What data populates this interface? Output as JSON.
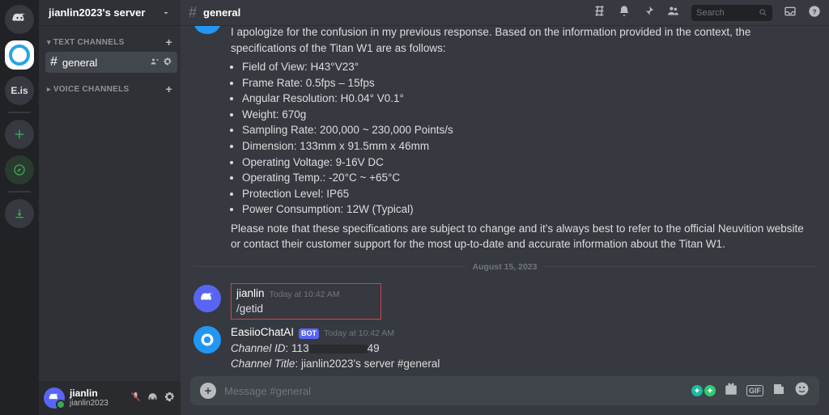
{
  "server_rail": {
    "items": [
      "discord",
      "selected",
      "eis",
      "add",
      "explore",
      "download"
    ],
    "eis_label": "E.is"
  },
  "sidebar": {
    "server_name": "jianlin2023's server",
    "groups": [
      {
        "label": "TEXT CHANNELS",
        "channels": [
          {
            "name": "general",
            "active": true
          }
        ]
      },
      {
        "label": "VOICE CHANNELS",
        "channels": []
      }
    ]
  },
  "user_panel": {
    "display_name": "jianlin",
    "username": "jianlin2023"
  },
  "topbar": {
    "channel_name": "general",
    "search_placeholder": "Search"
  },
  "messages": {
    "partial_top": {
      "text_before_list": "I apologize for the confusion in my previous response. Based on the information provided in the context, the specifications of the Titan W1 are as follows:",
      "specs": [
        "Field of View: H43°V23°",
        "Frame Rate: 0.5fps – 15fps",
        "Angular Resolution: H0.04° V0.1°",
        "Weight: 670g",
        "Sampling Rate: 200,000 ~ 230,000 Points/s",
        "Dimension: 133mm x 91.5mm x 46mm",
        "Operating Voltage: 9-16V DC",
        "Operating Temp.: -20°C ~ +65°C",
        "Protection Level: IP65",
        "Power Consumption: 12W (Typical)"
      ],
      "text_after_list": "Please note that these specifications are subject to change and it's always best to refer to the official Neuvition website or contact their customer support for the most up-to-date and accurate information about the Titan W1."
    },
    "date_divider": "August 15, 2023",
    "user_msg": {
      "author": "jianlin",
      "timestamp": "Today at 10:42 AM",
      "content": "/getid"
    },
    "bot_msg": {
      "author": "EasiioChatAI",
      "bot_tag": "BOT",
      "timestamp": "Today at 10:42 AM",
      "line1_label": "Channel ID",
      "line1_prefix": ": 113",
      "line1_suffix": "49",
      "line2_label": "Channel Title",
      "line2_value": ": jianlin2023's server #general"
    }
  },
  "input": {
    "placeholder": "Message #general",
    "gif_label": "GIF"
  }
}
